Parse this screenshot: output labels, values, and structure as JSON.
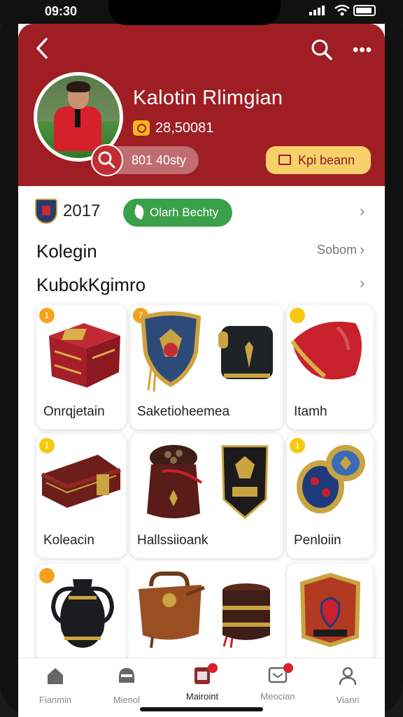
{
  "status": {
    "time": "09:30"
  },
  "header": {
    "profile_name": "Kalotin Rlimgian",
    "coins": "28,50081",
    "pill_label": "801 40sty",
    "yellow_button_label": "Kpi beann"
  },
  "club": {
    "year": "2017",
    "green_button_label": "Olarh Bechty"
  },
  "sections": {
    "first_title": "Kolegin",
    "see_all_label": "Sobom",
    "second_title": "KubokKgimro"
  },
  "items": [
    {
      "label": "Onrqjetain",
      "badge": "1"
    },
    {
      "label": "Saketioheemea",
      "badge": "7"
    },
    {
      "label": "",
      "badge": ""
    },
    {
      "label": "Itamh",
      "badge": ""
    },
    {
      "label": "Koleacin",
      "badge": "1"
    },
    {
      "label": "Hallssiioank",
      "badge": ""
    },
    {
      "label": "",
      "badge": ""
    },
    {
      "label": "Penloiin",
      "badge": "1"
    }
  ],
  "tabs": [
    {
      "label": "Fianmin",
      "icon": "home-icon"
    },
    {
      "label": "Mienol",
      "icon": "helmet-icon"
    },
    {
      "label": "Mairoint",
      "icon": "collection-icon"
    },
    {
      "label": "Meocian",
      "icon": "chat-icon"
    },
    {
      "label": "Viann",
      "icon": "profile-icon"
    }
  ],
  "colors": {
    "header": "#9e1e24",
    "accent_green": "#3aa14a",
    "accent_yellow": "#f7d06a"
  }
}
